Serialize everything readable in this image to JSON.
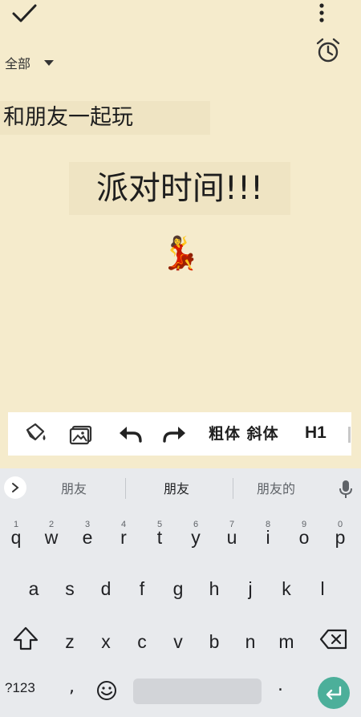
{
  "header": {
    "category": "全部"
  },
  "note": {
    "subtitle": "和朋友一起玩",
    "heading": "派对时间!!!",
    "emoji": "💃"
  },
  "toolbar": {
    "bold_italic": "粗体 斜体",
    "h1": "H1"
  },
  "keyboard": {
    "suggestions": [
      "朋友",
      "朋友",
      "朋友的"
    ],
    "row1": [
      "q",
      "w",
      "e",
      "r",
      "t",
      "y",
      "u",
      "i",
      "o",
      "p"
    ],
    "row1_nums": [
      "1",
      "2",
      "3",
      "4",
      "5",
      "6",
      "7",
      "8",
      "9",
      "0"
    ],
    "row2": [
      "a",
      "s",
      "d",
      "f",
      "g",
      "h",
      "j",
      "k",
      "l"
    ],
    "row3": [
      "z",
      "x",
      "c",
      "v",
      "b",
      "n",
      "m"
    ],
    "symbols": "?123",
    "comma": ",",
    "period": "."
  },
  "colors": {
    "background": "#f5ebcc",
    "highlight": "#efe4c3",
    "keyboard_bg": "#e8eaed",
    "enter_key": "#4caf9a"
  },
  "icons": {
    "check": "check-icon",
    "more": "more-vertical-icon",
    "dropdown": "caret-down-icon",
    "alarm": "alarm-clock-icon",
    "paint": "paint-bucket-icon",
    "image": "image-icon",
    "undo": "undo-icon",
    "redo": "redo-icon",
    "expand": "chevron-right-icon",
    "mic": "microphone-icon",
    "shift": "shift-icon",
    "backspace": "backspace-icon",
    "emoji": "emoji-icon",
    "enter": "enter-icon"
  }
}
